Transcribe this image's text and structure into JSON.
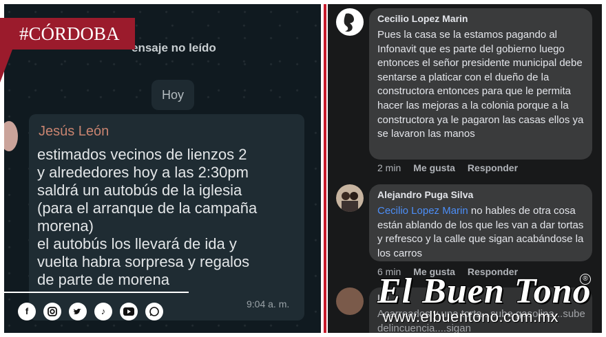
{
  "badge": {
    "hashtag": "#CÓRDOBA"
  },
  "chat": {
    "unread_label": "ensaje no leído",
    "date_chip": "Hoy",
    "message": {
      "sender": "Jesús León",
      "text": "estimados vecinos de lienzos 2\ny alrededores hoy a las 2:30pm\nsaldrá un autobús de la iglesia\n(para el arranque de la campaña\nmorena)\nel autobús los llevará de ida y\nvuelta habra sorpresa y regalos\nde parte de morena",
      "time": "9:04 a. m."
    }
  },
  "social_icons": [
    "facebook-icon",
    "instagram-icon",
    "twitter-icon",
    "tiktok-icon",
    "youtube-icon",
    "whatsapp-icon"
  ],
  "comments": [
    {
      "author": "Cecilio Lopez Marin",
      "text": "Pues la casa se la estamos pagando al Infonavit que es parte del gobierno luego entonces el señor presidente municipal debe sentarse a platicar con el dueño de la constructora entonces para que le permita hacer las mejoras a la colonia porque a la constructora ya le pagaron las casas ellos ya se lavaron las manos",
      "time": "2 min",
      "like": "Me gusta",
      "reply": "Responder"
    },
    {
      "author": "Alejandro Puga Silva",
      "mention": "Cecilio Lopez Marin",
      "text": " no hables de otra cosa están ablando de los que les van a dar tortas y refresco y la calle que sigan acabándose la los carros",
      "time": "6 min",
      "like": "Me gusta",
      "reply": "Responder"
    },
    {
      "author": "Lu...",
      "text": "Acarreados y una torta...sube gasolina...sube delincuencia....sigan"
    }
  ],
  "watermark": {
    "brand": "El Buen Tono",
    "registered": "®",
    "url": "www.elbuentono.com.mx"
  },
  "colors": {
    "accent_red": "#c61a2b",
    "badge_red": "#9b1b2c",
    "mention_blue": "#4c8ef7"
  }
}
